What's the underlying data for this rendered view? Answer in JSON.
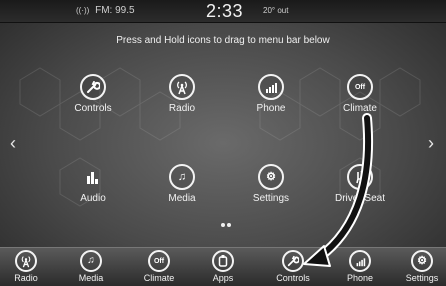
{
  "status": {
    "radio": "FM: 99.5",
    "clock": "2:33",
    "outside_temp": "20° out"
  },
  "instructions": "Press and Hold icons to drag to menu bar below",
  "grid": [
    {
      "label": "Controls",
      "icon": "wrench-icon"
    },
    {
      "label": "Radio",
      "icon": "radio-tower-icon"
    },
    {
      "label": "Phone",
      "icon": "phone-signal-icon"
    },
    {
      "label": "Climate",
      "icon": "climate-off-icon",
      "icon_text": "Off"
    },
    {
      "label": "Audio",
      "icon": "equalizer-icon"
    },
    {
      "label": "Media",
      "icon": "music-note-icon"
    },
    {
      "label": "Settings",
      "icon": "gear-icon"
    },
    {
      "label": "Driver Seat",
      "icon": "heated-seat-icon"
    }
  ],
  "menubar": [
    {
      "label": "Radio",
      "icon": "radio-tower-icon"
    },
    {
      "label": "Media",
      "icon": "music-note-icon"
    },
    {
      "label": "Climate",
      "icon": "climate-off-icon",
      "icon_text": "Off"
    },
    {
      "label": "Apps",
      "icon": "apps-icon"
    },
    {
      "label": "Controls",
      "icon": "wrench-icon"
    },
    {
      "label": "Phone",
      "icon": "phone-signal-icon"
    },
    {
      "label": "Settings",
      "icon": "gear-icon"
    }
  ],
  "pagination": {
    "pages": 2,
    "current": 1
  },
  "colors": {
    "icon": "#f3f3f3",
    "text": "#f2f2f2",
    "background": "#4a4a4a",
    "arrow": "#111111"
  }
}
